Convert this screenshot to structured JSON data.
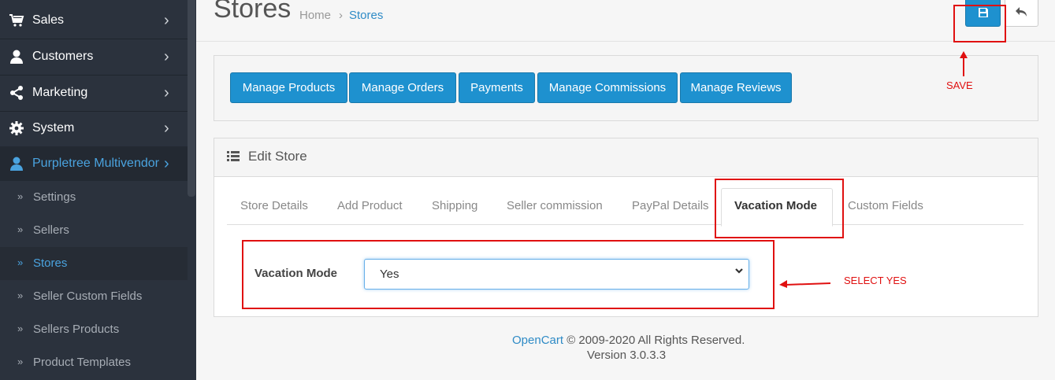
{
  "sidebar": {
    "items": [
      {
        "label": "Sales",
        "icon": "cart-icon"
      },
      {
        "label": "Customers",
        "icon": "user-icon"
      },
      {
        "label": "Marketing",
        "icon": "share-icon"
      },
      {
        "label": "System",
        "icon": "gear-icon"
      },
      {
        "label": "Purpletree Multivendor",
        "icon": "user-icon"
      }
    ],
    "subitems": [
      {
        "label": "Settings"
      },
      {
        "label": "Sellers"
      },
      {
        "label": "Stores"
      },
      {
        "label": "Seller Custom Fields"
      },
      {
        "label": "Sellers Products"
      },
      {
        "label": "Product Templates"
      }
    ],
    "chevron": "›",
    "sub_arrow": "»"
  },
  "header": {
    "title": "Stores",
    "breadcrumb_home": "Home",
    "breadcrumb_sep": "›",
    "breadcrumb_current": "Stores"
  },
  "toolbar": {
    "buttons": [
      "Manage Products",
      "Manage Orders",
      "Payments",
      "Manage Commissions",
      "Manage Reviews"
    ]
  },
  "panel": {
    "title": "Edit Store",
    "tabs": [
      "Store Details",
      "Add Product",
      "Shipping",
      "Seller commission",
      "PayPal Details",
      "Vacation Mode",
      "Custom Fields"
    ],
    "field_label": "Vacation Mode",
    "field_value": "Yes"
  },
  "annotations": {
    "save": "SAVE",
    "select_yes": "SELECT YES",
    "color": "#e01010"
  },
  "footer": {
    "brand": "OpenCart",
    "copyright": " © 2009-2020 All Rights Reserved.",
    "version": "Version 3.0.3.3"
  },
  "colors": {
    "sidebar_bg": "#2b323d",
    "primary": "#1e91cf",
    "link": "#2f8bc6"
  }
}
